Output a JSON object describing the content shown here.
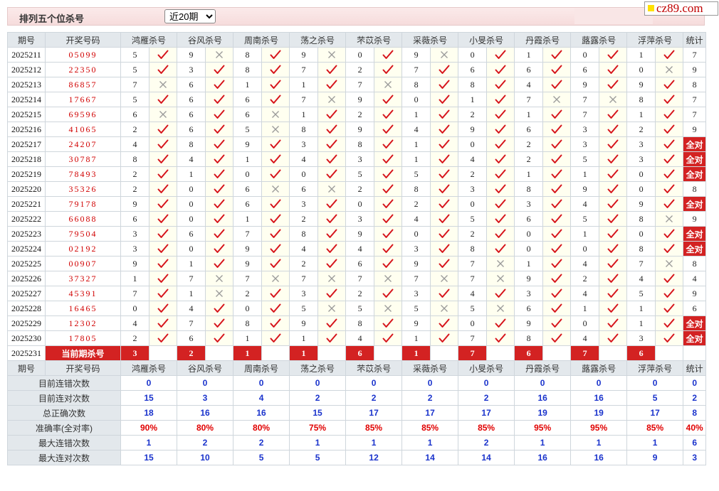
{
  "header": {
    "title": "排列五个位杀号",
    "period_select": "近20期",
    "site_logo": "cz89.com"
  },
  "columns": {
    "period": "期号",
    "draw": "开奖号码",
    "methods": [
      "鸿雁杀号",
      "谷风杀号",
      "周南杀号",
      "荡之杀号",
      "芣苡杀号",
      "采薇杀号",
      "小旻杀号",
      "丹霞杀号",
      "蕗露杀号",
      "浮萍杀号"
    ],
    "stats": "统计"
  },
  "rows": [
    {
      "period": "2025211",
      "draw": "05099",
      "kills": [
        [
          5,
          1
        ],
        [
          9,
          0
        ],
        [
          8,
          1
        ],
        [
          9,
          0
        ],
        [
          0,
          1
        ],
        [
          9,
          0
        ],
        [
          0,
          1
        ],
        [
          1,
          1
        ],
        [
          0,
          1
        ],
        [
          1,
          1
        ]
      ],
      "stat": "7"
    },
    {
      "period": "2025212",
      "draw": "22350",
      "kills": [
        [
          5,
          1
        ],
        [
          3,
          1
        ],
        [
          8,
          1
        ],
        [
          7,
          1
        ],
        [
          2,
          1
        ],
        [
          7,
          1
        ],
        [
          6,
          1
        ],
        [
          6,
          1
        ],
        [
          6,
          1
        ],
        [
          0,
          0
        ]
      ],
      "stat": "9"
    },
    {
      "period": "2025213",
      "draw": "86857",
      "kills": [
        [
          7,
          0
        ],
        [
          6,
          1
        ],
        [
          1,
          1
        ],
        [
          1,
          1
        ],
        [
          7,
          0
        ],
        [
          8,
          1
        ],
        [
          8,
          1
        ],
        [
          4,
          1
        ],
        [
          9,
          1
        ],
        [
          9,
          1
        ]
      ],
      "stat": "8"
    },
    {
      "period": "2025214",
      "draw": "17667",
      "kills": [
        [
          5,
          1
        ],
        [
          6,
          1
        ],
        [
          6,
          1
        ],
        [
          7,
          0
        ],
        [
          9,
          1
        ],
        [
          0,
          1
        ],
        [
          1,
          1
        ],
        [
          7,
          0
        ],
        [
          7,
          0
        ],
        [
          8,
          1
        ]
      ],
      "stat": "7"
    },
    {
      "period": "2025215",
      "draw": "69596",
      "kills": [
        [
          6,
          0
        ],
        [
          6,
          1
        ],
        [
          6,
          0
        ],
        [
          1,
          1
        ],
        [
          2,
          1
        ],
        [
          1,
          1
        ],
        [
          2,
          1
        ],
        [
          1,
          1
        ],
        [
          7,
          1
        ],
        [
          1,
          1
        ]
      ],
      "stat": "7"
    },
    {
      "period": "2025216",
      "draw": "41065",
      "kills": [
        [
          2,
          1
        ],
        [
          6,
          1
        ],
        [
          5,
          0
        ],
        [
          8,
          1
        ],
        [
          9,
          1
        ],
        [
          4,
          1
        ],
        [
          9,
          1
        ],
        [
          6,
          1
        ],
        [
          3,
          1
        ],
        [
          2,
          1
        ]
      ],
      "stat": "9"
    },
    {
      "period": "2025217",
      "draw": "24207",
      "kills": [
        [
          4,
          1
        ],
        [
          8,
          1
        ],
        [
          9,
          1
        ],
        [
          3,
          1
        ],
        [
          8,
          1
        ],
        [
          1,
          1
        ],
        [
          0,
          1
        ],
        [
          2,
          1
        ],
        [
          3,
          1
        ],
        [
          3,
          1
        ]
      ],
      "stat": "全对"
    },
    {
      "period": "2025218",
      "draw": "30787",
      "kills": [
        [
          8,
          1
        ],
        [
          4,
          1
        ],
        [
          1,
          1
        ],
        [
          4,
          1
        ],
        [
          3,
          1
        ],
        [
          1,
          1
        ],
        [
          4,
          1
        ],
        [
          2,
          1
        ],
        [
          5,
          1
        ],
        [
          3,
          1
        ]
      ],
      "stat": "全对"
    },
    {
      "period": "2025219",
      "draw": "78493",
      "kills": [
        [
          2,
          1
        ],
        [
          1,
          1
        ],
        [
          0,
          1
        ],
        [
          0,
          1
        ],
        [
          5,
          1
        ],
        [
          5,
          1
        ],
        [
          2,
          1
        ],
        [
          1,
          1
        ],
        [
          1,
          1
        ],
        [
          0,
          1
        ]
      ],
      "stat": "全对"
    },
    {
      "period": "2025220",
      "draw": "35326",
      "kills": [
        [
          2,
          1
        ],
        [
          0,
          1
        ],
        [
          6,
          0
        ],
        [
          6,
          0
        ],
        [
          2,
          1
        ],
        [
          8,
          1
        ],
        [
          3,
          1
        ],
        [
          8,
          1
        ],
        [
          9,
          1
        ],
        [
          0,
          1
        ]
      ],
      "stat": "8"
    },
    {
      "period": "2025221",
      "draw": "79178",
      "kills": [
        [
          9,
          1
        ],
        [
          0,
          1
        ],
        [
          6,
          1
        ],
        [
          3,
          1
        ],
        [
          0,
          1
        ],
        [
          2,
          1
        ],
        [
          0,
          1
        ],
        [
          3,
          1
        ],
        [
          4,
          1
        ],
        [
          9,
          1
        ]
      ],
      "stat": "全对"
    },
    {
      "period": "2025222",
      "draw": "66088",
      "kills": [
        [
          6,
          1
        ],
        [
          0,
          1
        ],
        [
          1,
          1
        ],
        [
          2,
          1
        ],
        [
          3,
          1
        ],
        [
          4,
          1
        ],
        [
          5,
          1
        ],
        [
          6,
          1
        ],
        [
          5,
          1
        ],
        [
          8,
          0
        ]
      ],
      "stat": "9"
    },
    {
      "period": "2025223",
      "draw": "79504",
      "kills": [
        [
          3,
          1
        ],
        [
          6,
          1
        ],
        [
          7,
          1
        ],
        [
          8,
          1
        ],
        [
          9,
          1
        ],
        [
          0,
          1
        ],
        [
          2,
          1
        ],
        [
          0,
          1
        ],
        [
          1,
          1
        ],
        [
          0,
          1
        ]
      ],
      "stat": "全对"
    },
    {
      "period": "2025224",
      "draw": "02192",
      "kills": [
        [
          3,
          1
        ],
        [
          0,
          1
        ],
        [
          9,
          1
        ],
        [
          4,
          1
        ],
        [
          4,
          1
        ],
        [
          3,
          1
        ],
        [
          8,
          1
        ],
        [
          0,
          1
        ],
        [
          0,
          1
        ],
        [
          8,
          1
        ]
      ],
      "stat": "全对"
    },
    {
      "period": "2025225",
      "draw": "00907",
      "kills": [
        [
          9,
          1
        ],
        [
          1,
          1
        ],
        [
          9,
          1
        ],
        [
          2,
          1
        ],
        [
          6,
          1
        ],
        [
          9,
          1
        ],
        [
          7,
          0
        ],
        [
          1,
          1
        ],
        [
          4,
          1
        ],
        [
          7,
          0
        ]
      ],
      "stat": "8"
    },
    {
      "period": "2025226",
      "draw": "37327",
      "kills": [
        [
          1,
          1
        ],
        [
          7,
          0
        ],
        [
          7,
          0
        ],
        [
          7,
          0
        ],
        [
          7,
          0
        ],
        [
          7,
          0
        ],
        [
          7,
          0
        ],
        [
          9,
          1
        ],
        [
          2,
          1
        ],
        [
          4,
          1
        ]
      ],
      "stat": "4"
    },
    {
      "period": "2025227",
      "draw": "45391",
      "kills": [
        [
          7,
          1
        ],
        [
          1,
          0
        ],
        [
          2,
          1
        ],
        [
          3,
          1
        ],
        [
          2,
          1
        ],
        [
          3,
          1
        ],
        [
          4,
          1
        ],
        [
          3,
          1
        ],
        [
          4,
          1
        ],
        [
          5,
          1
        ]
      ],
      "stat": "9"
    },
    {
      "period": "2025228",
      "draw": "16465",
      "kills": [
        [
          0,
          1
        ],
        [
          4,
          1
        ],
        [
          0,
          1
        ],
        [
          5,
          0
        ],
        [
          5,
          0
        ],
        [
          5,
          0
        ],
        [
          5,
          0
        ],
        [
          6,
          1
        ],
        [
          1,
          1
        ],
        [
          1,
          1
        ]
      ],
      "stat": "6"
    },
    {
      "period": "2025229",
      "draw": "12302",
      "kills": [
        [
          4,
          1
        ],
        [
          7,
          1
        ],
        [
          8,
          1
        ],
        [
          9,
          1
        ],
        [
          8,
          1
        ],
        [
          9,
          1
        ],
        [
          0,
          1
        ],
        [
          9,
          1
        ],
        [
          0,
          1
        ],
        [
          1,
          1
        ]
      ],
      "stat": "全对"
    },
    {
      "period": "2025230",
      "draw": "17805",
      "kills": [
        [
          2,
          1
        ],
        [
          6,
          1
        ],
        [
          1,
          1
        ],
        [
          1,
          1
        ],
        [
          4,
          1
        ],
        [
          1,
          1
        ],
        [
          7,
          1
        ],
        [
          8,
          1
        ],
        [
          4,
          1
        ],
        [
          3,
          1
        ]
      ],
      "stat": "全对"
    }
  ],
  "current": {
    "period": "2025231",
    "label": "当前期杀号",
    "kills": [
      "3",
      "2",
      "1",
      "1",
      "6",
      "1",
      "7",
      "6",
      "7",
      "6"
    ]
  },
  "summary": [
    {
      "label": "目前连错次数",
      "values": [
        "0",
        "0",
        "0",
        "0",
        "0",
        "0",
        "0",
        "0",
        "0",
        "0",
        "0"
      ]
    },
    {
      "label": "目前连对次数",
      "values": [
        "15",
        "3",
        "4",
        "2",
        "2",
        "2",
        "2",
        "16",
        "16",
        "5",
        "2"
      ]
    },
    {
      "label": "总正确次数",
      "values": [
        "18",
        "16",
        "16",
        "15",
        "17",
        "17",
        "17",
        "19",
        "19",
        "17",
        "8"
      ]
    },
    {
      "label": "准确率(全对率)",
      "values": [
        "90%",
        "80%",
        "80%",
        "75%",
        "85%",
        "85%",
        "85%",
        "95%",
        "95%",
        "85%",
        "40%"
      ]
    },
    {
      "label": "最大连错次数",
      "values": [
        "1",
        "2",
        "2",
        "1",
        "1",
        "1",
        "2",
        "1",
        "1",
        "1",
        "6"
      ]
    },
    {
      "label": "最大连对次数",
      "values": [
        "15",
        "10",
        "5",
        "5",
        "12",
        "14",
        "14",
        "16",
        "16",
        "9",
        "3"
      ]
    }
  ],
  "colors": {
    "check": "#d6141b",
    "cross": "#9a9a9a",
    "red_bg": "#d32222",
    "stat_blue": "#1a33cc",
    "accuracy_red": "#e10000",
    "header_bg": "#e3e8ec"
  }
}
